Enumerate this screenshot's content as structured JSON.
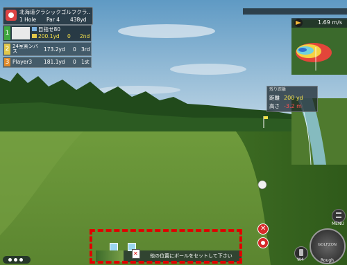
{
  "course": {
    "name": "北海道クラシックゴルフクラ..",
    "hole": "1 Hole",
    "par": "Par 4",
    "distance": "438yd"
  },
  "players": [
    {
      "rank": "1",
      "name": "目指せ80",
      "yards": "200.1yd",
      "strokes": "0",
      "place": "2nd",
      "color": "#3fa63f"
    },
    {
      "rank": "2",
      "name": "24室素ンバス",
      "yards": "173.2yd",
      "strokes": "0",
      "place": "3rd",
      "color": "#e0c64a"
    },
    {
      "rank": "3",
      "name": "Player3",
      "yards": "181.1yd",
      "strokes": "0",
      "place": "1st",
      "color": "#e08a2a"
    }
  ],
  "wind": {
    "speed": "1.69 m/s"
  },
  "distance_box": {
    "title": "残り距離",
    "dist_label": "距離",
    "dist_value": "200 yd",
    "height_label": "高さ",
    "height_value": "-3.2 m"
  },
  "bottom_bar": {
    "message": "他の位置にボールをセットして下さい"
  },
  "controls": {
    "menu_label": "MENU",
    "club_label": "W4",
    "lie_label": "Rough",
    "swing_label": "GOLFZON"
  },
  "colors": {
    "sky": "#8fb8d6",
    "grass": "#7ea34a",
    "highlight": "#e00000",
    "height_value": "#ff5050",
    "dist_value": "#f6e24a"
  }
}
